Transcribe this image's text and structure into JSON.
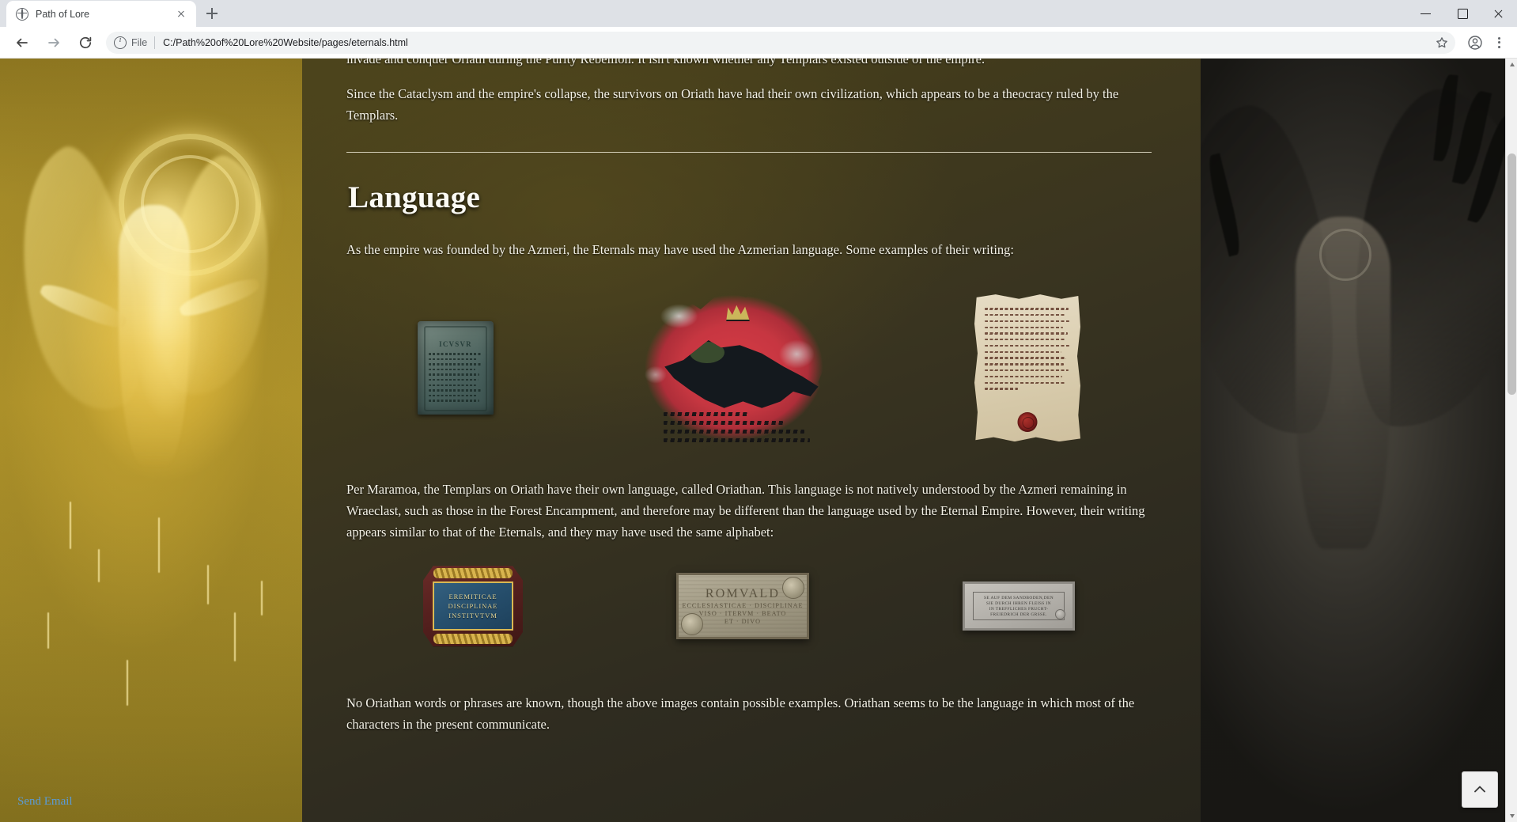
{
  "browser": {
    "tab": {
      "title": "Path of Lore",
      "favicon": "globe-icon"
    },
    "newtab_tooltip": "New Tab",
    "omnibox": {
      "scheme_label": "File",
      "url": "C:/Path%20of%20Lore%20Website/pages/eternals.html"
    },
    "window_controls": {
      "minimize": "minimize-icon",
      "maximize": "maximize-icon",
      "close": "close-icon"
    }
  },
  "page": {
    "clipped_top_line": "invade and conquer Oriath during the Purity Rebellion. It isn't known whether any Templars existed outside of the empire.",
    "intro_paragraph": "Since the Cataclysm and the empire's collapse, the survivors on Oriath have had their own civilization, which appears to be a theocracy ruled by the Templars.",
    "section_title": "Language",
    "paragraph_1": "As the empire was founded by the Azmeri, the Eternals may have used the Azmerian language. Some examples of their writing:",
    "paragraph_2": "Per Maramoa, the Templars on Oriath have their own language, called Oriathan. This language is not natively understood by the Azmeri remaining in Wraeclast, such as those in the Forest Encampment, and therefore may be different than the language used by the Eternal Empire. However, their writing appears similar to that of the Eternals, and they may have used the same alphabet:",
    "paragraph_3": "No Oriathan words or phrases are known, though the above images contain possible examples. Oriathan seems to be the language in which most of the characters in the present communicate.",
    "footer_link": "Send Email",
    "scroll_top_button": "chevron-up-icon",
    "artifacts_row_1": [
      {
        "name": "stone-tablet",
        "caption_text": "ICVSVR",
        "alt": "Eternal stone tablet with inscription"
      },
      {
        "name": "red-banner",
        "caption_text": "",
        "alt": "Red banner with black lion and Azmerian script"
      },
      {
        "name": "parchment-scroll",
        "caption_text": "",
        "alt": "Aged parchment with cursive text and wax seal"
      }
    ],
    "artifacts_row_2": [
      {
        "name": "gilt-plaque",
        "lines": [
          "EREMITICAE",
          "DISCIPLINAE",
          "INSTITVTVM"
        ]
      },
      {
        "name": "romuald-stone",
        "title": "ROMVALD",
        "lines": [
          "ECCLESIASTICAE · DISCIPLINAE",
          "VISO · ITERVM · BEATO",
          "ET · DIVO"
        ]
      },
      {
        "name": "german-stone-sign",
        "lines": [
          "SE AUF DEM SANDBODEN,DEN",
          "SIE DURCH IHREN FLEISS IN",
          "IN TREFFLICHES FRUCHT-",
          "FREIEDRICH DER GRSSE."
        ]
      }
    ]
  },
  "colors": {
    "accent_link": "#5b9bd5",
    "page_text": "#f3f1e6",
    "left_panel": "#b79a2c",
    "right_panel": "#2d2b26",
    "chrome_tabstrip": "#dee1e6"
  }
}
